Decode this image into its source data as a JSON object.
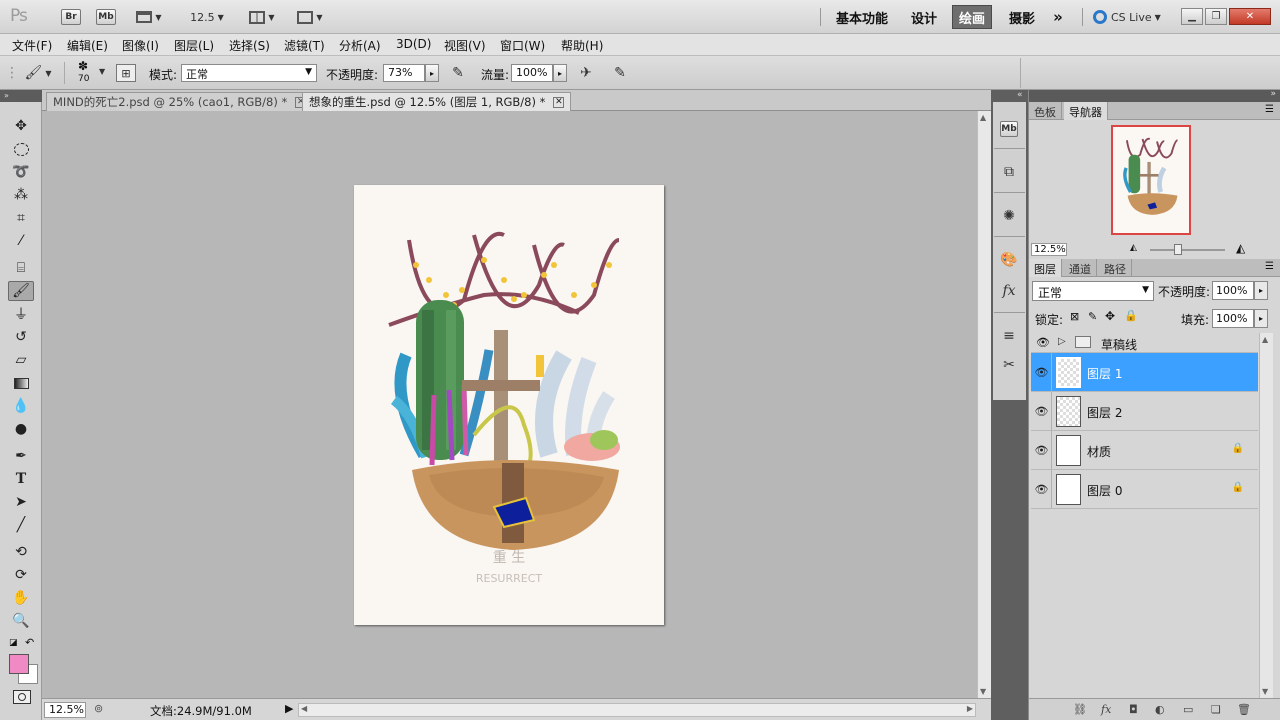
{
  "app": {
    "logo": "Ps",
    "zoom": "12.5"
  },
  "appbar": {
    "badges": [
      "Br",
      "Mb"
    ],
    "workspaces": [
      {
        "label": "基本功能",
        "active": false
      },
      {
        "label": "设计",
        "active": false
      },
      {
        "label": "绘画",
        "active": true
      },
      {
        "label": "摄影",
        "active": false
      }
    ],
    "more": "»",
    "cslive": "CS Live"
  },
  "menu": [
    "文件(F)",
    "编辑(E)",
    "图像(I)",
    "图层(L)",
    "选择(S)",
    "滤镜(T)",
    "分析(A)",
    "3D(D)",
    "视图(V)",
    "窗口(W)",
    "帮助(H)"
  ],
  "options": {
    "brush_size": "70",
    "mode_label": "模式:",
    "mode_value": "正常",
    "opacity_label": "不透明度:",
    "opacity_value": "73%",
    "flow_label": "流量:",
    "flow_value": "100%"
  },
  "tabs": [
    {
      "title": "MIND的死亡2.psd @ 25% (cao1, RGB/8) *",
      "active": false
    },
    {
      "title": "想象的重生.psd @ 12.5% (图层 1, RGB/8) *",
      "active": true
    }
  ],
  "artwork": {
    "caption_cn": "重 生",
    "caption_en": "RESURRECT"
  },
  "status": {
    "zoom": "12.5%",
    "doc_label": "文档:24.9M/91.0M"
  },
  "panels": {
    "top_tabs": [
      "色板",
      "导航器"
    ],
    "nav_zoom": "12.5%",
    "layer_tabs": [
      "图层",
      "通道",
      "路径"
    ],
    "blend_mode": "正常",
    "opacity_label": "不透明度:",
    "opacity_value": "100%",
    "lock_label": "锁定:",
    "fill_label": "填充:",
    "fill_value": "100%"
  },
  "layers": [
    {
      "name": "草稿线",
      "type": "group"
    },
    {
      "name": "图层 1",
      "selected": true
    },
    {
      "name": "图层 2"
    },
    {
      "name": "材质",
      "locked": true
    },
    {
      "name": "图层 0",
      "locked": true
    }
  ],
  "colors": {
    "foreground": "#ef8ac4",
    "background": "#ffffff",
    "selection": "#3ba0ff",
    "active_workspace": "#6e6e6e"
  }
}
